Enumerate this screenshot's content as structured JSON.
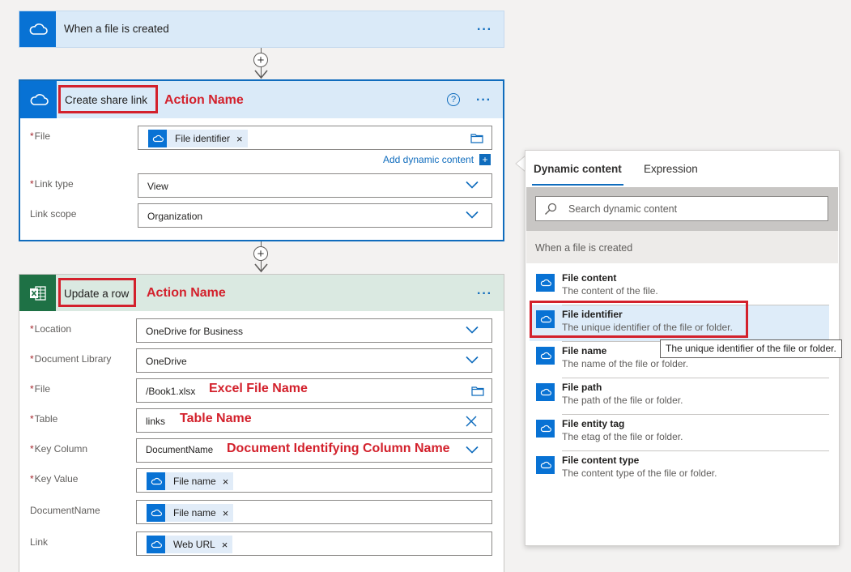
{
  "trigger": {
    "title": "When a file is created",
    "menu": "···"
  },
  "share_action": {
    "title": "Create share link",
    "annotation": "Action Name",
    "help": "?",
    "menu": "···",
    "fields": {
      "file_label": "File",
      "file_token": "File identifier",
      "add_dynamic": "Add dynamic content",
      "link_type_label": "Link type",
      "link_type_value": "View",
      "link_scope_label": "Link scope",
      "link_scope_value": "Organization"
    }
  },
  "update_action": {
    "title": "Update a row",
    "annotation": "Action Name",
    "menu": "···",
    "fields": [
      {
        "label": "Location",
        "required": true,
        "value": "OneDrive for Business",
        "kind": "select"
      },
      {
        "label": "Document Library",
        "required": true,
        "value": "OneDrive",
        "kind": "select"
      },
      {
        "label": "File",
        "required": true,
        "value": "/Book1.xlsx",
        "kind": "file",
        "annotation": "Excel File Name"
      },
      {
        "label": "Table",
        "required": true,
        "value": "links",
        "kind": "clear",
        "annotation": "Table Name"
      },
      {
        "label": "Key Column",
        "required": true,
        "value": "DocumentName",
        "kind": "select",
        "annotation": "Document Identifying Column Name"
      },
      {
        "label": "Key Value",
        "required": true,
        "token": "File name",
        "kind": "token"
      },
      {
        "label": "DocumentName",
        "required": false,
        "token": "File name",
        "kind": "token"
      },
      {
        "label": "Link",
        "required": false,
        "token": "Web URL",
        "kind": "token"
      }
    ]
  },
  "dynamic_panel": {
    "tabs": [
      "Dynamic content",
      "Expression"
    ],
    "search_placeholder": "Search dynamic content",
    "section": "When a file is created",
    "items": [
      {
        "title": "File content",
        "desc": "The content of the file."
      },
      {
        "title": "File identifier",
        "desc": "The unique identifier of the file or folder."
      },
      {
        "title": "File name",
        "desc": "The name of the file or folder."
      },
      {
        "title": "File path",
        "desc": "The path of the file or folder."
      },
      {
        "title": "File entity tag",
        "desc": "The etag of the file or folder."
      },
      {
        "title": "File content type",
        "desc": "The content type of the file or folder."
      }
    ],
    "tooltip": "The unique identifier of the file or folder."
  },
  "colors": {
    "accent": "#0872d4",
    "excel": "#1e7145",
    "annotation": "#d3212c"
  }
}
